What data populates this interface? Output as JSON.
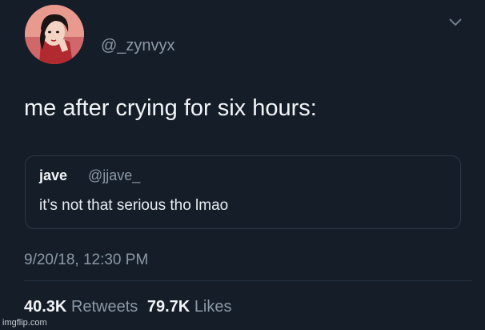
{
  "author": {
    "handle": "@_zynvyx",
    "avatar": "avatar-cartoon-woman"
  },
  "chevron_icon": "chevron-down-icon",
  "tweet": {
    "text": "me after crying for six hours:"
  },
  "quote": {
    "name": "jave",
    "handle": "@jjave_",
    "text": "it’s not that serious tho lmao"
  },
  "timestamp": "9/20/18, 12:30 PM",
  "stats": {
    "retweets_count": "40.3K",
    "retweets_label": "Retweets",
    "likes_count": "79.7K",
    "likes_label": "Likes"
  },
  "watermark": "imgflip.com",
  "colors": {
    "background": "#151d28",
    "secondary_text": "#8b98a5",
    "primary_text": "#f2f5f7"
  }
}
